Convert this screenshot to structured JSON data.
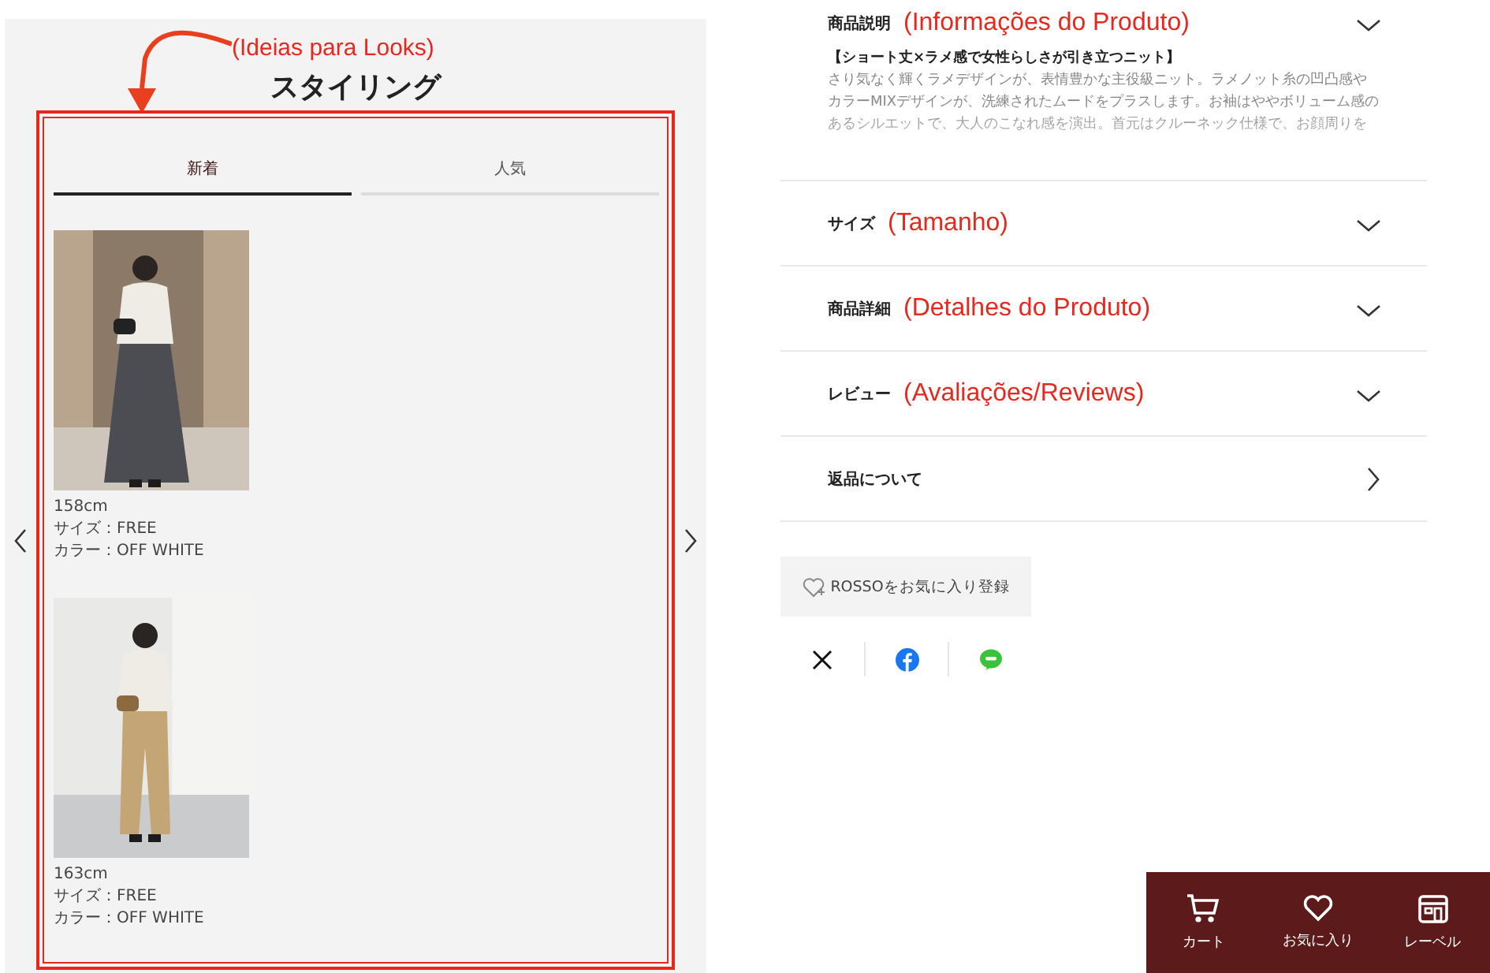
{
  "styling": {
    "annotation": "(Ideias para Looks)",
    "title": "スタイリング",
    "tabs": [
      {
        "label": "新着",
        "selected": true
      },
      {
        "label": "人気",
        "selected": false
      }
    ],
    "looks": [
      {
        "kind": "picture",
        "caption": [
          "158cm",
          "サイズ：FREE",
          "カラー：OFF WHITE"
        ]
      },
      {
        "kind": "picture",
        "caption": [
          "163cm",
          "サイズ：FREE",
          "カラー：OFF WHITE"
        ]
      }
    ]
  },
  "accordion": [
    {
      "label": "商品説明",
      "annotation": "(Informações do Produto)",
      "kind": "toggle",
      "content": {
        "heading": "【ショート丈×ラメ感で女性らしさが引き立つニット】",
        "lines": [
          "さり気なく輝くラメデザインが、表情豊かな主役級ニット。ラメノット糸の凹凸感や",
          "カラーMIXデザインが、洗練されたムードをプラスします。お袖はややボリューム感の",
          "あるシルエットで、大人のこなれ感を演出。首元はクルーネック仕様で、お顔周りを"
        ]
      }
    },
    {
      "label": "サイズ",
      "annotation": "(Tamanho)",
      "kind": "toggle"
    },
    {
      "label": "商品詳細",
      "annotation": "(Detalhes do Produto)",
      "kind": "toggle"
    },
    {
      "label": "レビュー",
      "annotation": "(Avaliações/Reviews)",
      "kind": "toggle"
    },
    {
      "label": "返品について",
      "kind": "link"
    }
  ],
  "favorite_button": "ROSSOをお気に入り登録",
  "bottom_nav": [
    "カート",
    "お気に入り",
    "レーベル"
  ]
}
